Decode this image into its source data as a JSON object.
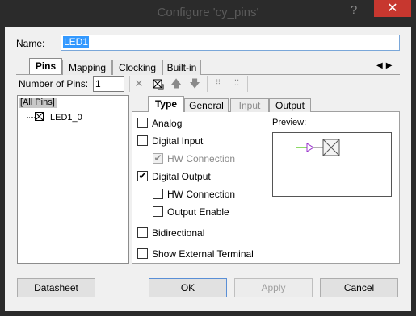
{
  "window": {
    "title": "Configure 'cy_pins'",
    "help_glyph": "?",
    "close_glyph": "✕"
  },
  "name_field": {
    "label": "Name:",
    "value": "LED1"
  },
  "outer_tabs": [
    {
      "label": "Pins",
      "active": true
    },
    {
      "label": "Mapping",
      "active": false
    },
    {
      "label": "Clocking",
      "active": false
    },
    {
      "label": "Built-in",
      "active": false
    }
  ],
  "tab_scroll_arrows": "◀▶",
  "pins_toolbar": {
    "number_of_pins_label": "Number of Pins:",
    "number_of_pins_value": "1",
    "icons": [
      "delete-icon",
      "add-pin-icon",
      "move-up-icon",
      "move-down-icon",
      "group-icon",
      "ungroup-icon"
    ]
  },
  "tree": {
    "root_label": "[All Pins]",
    "items": [
      {
        "label": "LED1_0"
      }
    ]
  },
  "inner_tabs": [
    {
      "label": "Type",
      "active": true,
      "disabled": false
    },
    {
      "label": "General",
      "active": false,
      "disabled": false
    },
    {
      "label": "Input",
      "active": false,
      "disabled": true
    },
    {
      "label": "Output",
      "active": false,
      "disabled": false
    }
  ],
  "type_options": {
    "analog": {
      "label": "Analog",
      "checked": false
    },
    "digital_input": {
      "label": "Digital Input",
      "checked": false
    },
    "di_hw_connection": {
      "label": "HW Connection",
      "checked": true,
      "disabled": true
    },
    "digital_output": {
      "label": "Digital Output",
      "checked": true
    },
    "do_hw_connection": {
      "label": "HW Connection",
      "checked": false
    },
    "output_enable": {
      "label": "Output Enable",
      "checked": false
    },
    "bidirectional": {
      "label": "Bidirectional",
      "checked": false
    },
    "show_external_terminal": {
      "label": "Show External Terminal",
      "checked": false
    }
  },
  "preview": {
    "label": "Preview:",
    "wire_color": "#66cc33",
    "buffer_color": "#9933cc"
  },
  "buttons": {
    "datasheet": "Datasheet",
    "ok": "OK",
    "apply": "Apply",
    "cancel": "Cancel"
  },
  "colors": {
    "selection": "#3399ff",
    "close_button": "#c7372f"
  }
}
